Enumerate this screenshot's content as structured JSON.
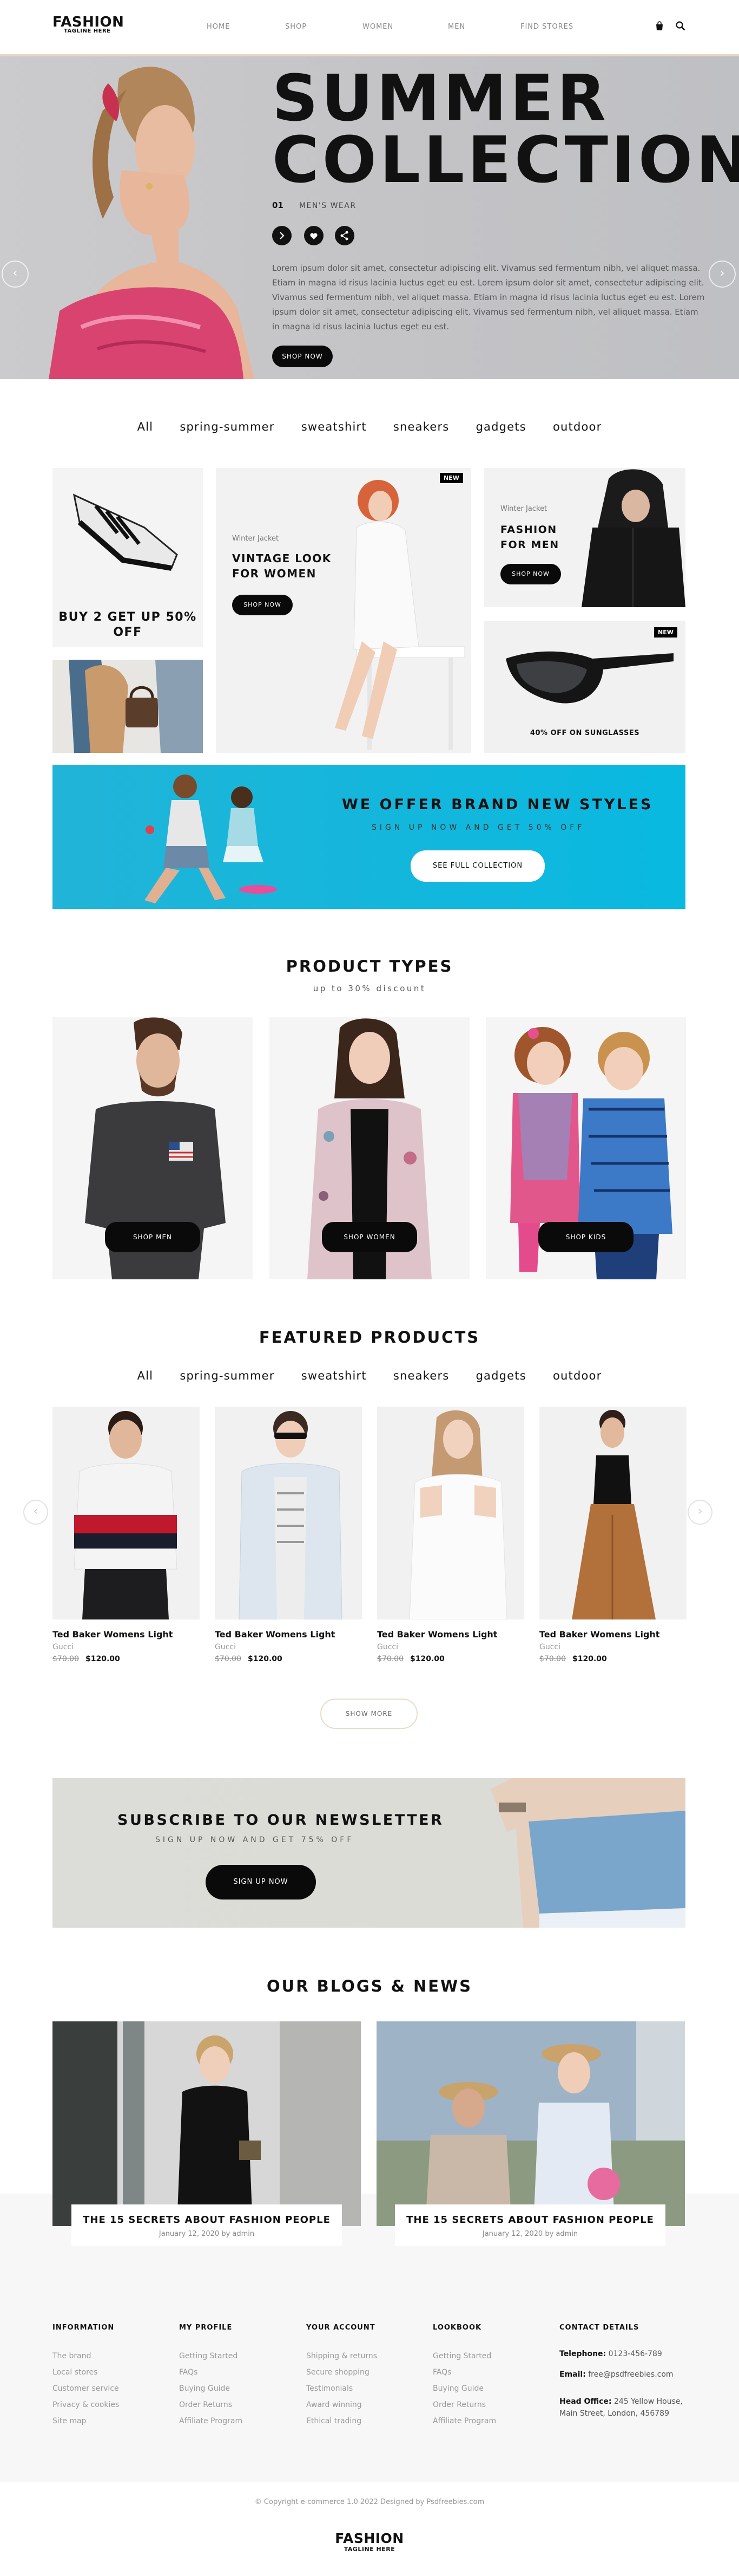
{
  "header": {
    "logo": "FASHION",
    "tagline": "TAGLINE HERE",
    "nav": [
      "HOME",
      "SHOP",
      "WOMEN",
      "MEN",
      "FIND STORES"
    ],
    "cart_icon": "bag-icon",
    "search_icon": "search-icon"
  },
  "hero": {
    "title_line1": "SUMMER",
    "title_line2": "COLLECTION",
    "slide_number": "01",
    "category": "MEN'S WEAR",
    "description": "Lorem ipsum dolor sit amet, consectetur adipiscing elit. Vivamus sed fermentum nibh, vel aliquet massa. Etiam in magna id risus lacinia luctus eget eu est. Lorem ipsum dolor sit amet, consectetur adipiscing elit. Vivamus sed fermentum nibh, vel aliquet massa. Etiam in magna id risus lacinia luctus eget eu est. Lorem ipsum dolor sit amet, consectetur adipiscing elit. Vivamus sed fermentum nibh, vel aliquet massa. Etiam in magna id risus lacinia luctus eget eu est.",
    "button": "SHOP NOW",
    "prev": "‹",
    "next": "›"
  },
  "filters": [
    "All",
    "spring-summer",
    "sweatshirt",
    "sneakers",
    "gadgets",
    "outdoor"
  ],
  "promos": {
    "buy2": "BUY 2 GET UP 50% OFF",
    "women_label": "Winter Jacket",
    "women_title_1": "VINTAGE LOOK",
    "women_title_2": "FOR WOMEN",
    "women_button": "SHOP NOW",
    "new_badge": "NEW",
    "men_label": "Winter Jacket",
    "men_title_1": "FASHION",
    "men_title_2": "FOR MEN",
    "men_button": "SHOP NOW",
    "sunglasses": "40% OFF ON SUNGLASSES"
  },
  "banner": {
    "title": "WE OFFER BRAND NEW STYLES",
    "subtitle": "SIGN UP NOW AND GET 50% OFF",
    "button": "SEE FULL COLLECTION"
  },
  "product_types": {
    "title": "PRODUCT TYPES",
    "subtitle": "up to 30% discount",
    "items": [
      "SHOP MEN",
      "SHOP WOMEN",
      "SHOP KIDS"
    ]
  },
  "featured": {
    "title": "FEATURED PRODUCTS",
    "show_more": "SHOW MORE",
    "products": [
      {
        "name": "Ted Baker Womens Light",
        "brand": "Gucci",
        "old_price": "$70.00",
        "price": "$120.00"
      },
      {
        "name": "Ted Baker Womens Light",
        "brand": "Gucci",
        "old_price": "$70.00",
        "price": "$120.00"
      },
      {
        "name": "Ted Baker Womens Light",
        "brand": "Gucci",
        "old_price": "$70.00",
        "price": "$120.00"
      },
      {
        "name": "Ted Baker Womens Light",
        "brand": "Gucci",
        "old_price": "$70.00",
        "price": "$120.00"
      }
    ]
  },
  "newsletter": {
    "title": "SUBSCRIBE TO OUR NEWSLETTER",
    "subtitle": "SIGN UP NOW AND GET 75% OFF",
    "button": "SIGN UP NOW"
  },
  "blogs": {
    "title": "OUR BLOGS & NEWS",
    "posts": [
      {
        "title": "THE 15 SECRETS ABOUT FASHION PEOPLE",
        "date": "January 12, 2020 by admin"
      },
      {
        "title": "THE 15 SECRETS ABOUT FASHION PEOPLE",
        "date": "January 12, 2020 by admin"
      }
    ]
  },
  "footer": {
    "columns": [
      {
        "title": "INFORMATION",
        "links": [
          "The brand",
          "Local stores",
          "Customer service",
          "Privacy & cookies",
          "Site map"
        ]
      },
      {
        "title": "MY PROFILE",
        "links": [
          "Getting Started",
          "FAQs",
          "Buying Guide",
          "Order Returns",
          "Affiliate Program"
        ]
      },
      {
        "title": "YOUR ACCOUNT",
        "links": [
          "Shipping & returns",
          "Secure shopping",
          "Testimonials",
          "Award winning",
          "Ethical trading"
        ]
      },
      {
        "title": "LOOKBOOK",
        "links": [
          "Getting Started",
          "FAQs",
          "Buying Guide",
          "Order Returns",
          "Affiliate Program"
        ]
      }
    ],
    "contact": {
      "title": "CONTACT DETAILS",
      "telephone_label": "Telephone:",
      "telephone": "0123-456-789",
      "email_label": "Email:",
      "email": "free@psdfreebies.com",
      "office_label": "Head Office:",
      "office": "245 Yellow House, Main Street, London, 456789"
    },
    "copyright": "© Copyright e-commerce 1.0 2022 Designed by Psdfreebies.com",
    "logo": "FASHION",
    "tagline": "TAGLINE HERE"
  }
}
